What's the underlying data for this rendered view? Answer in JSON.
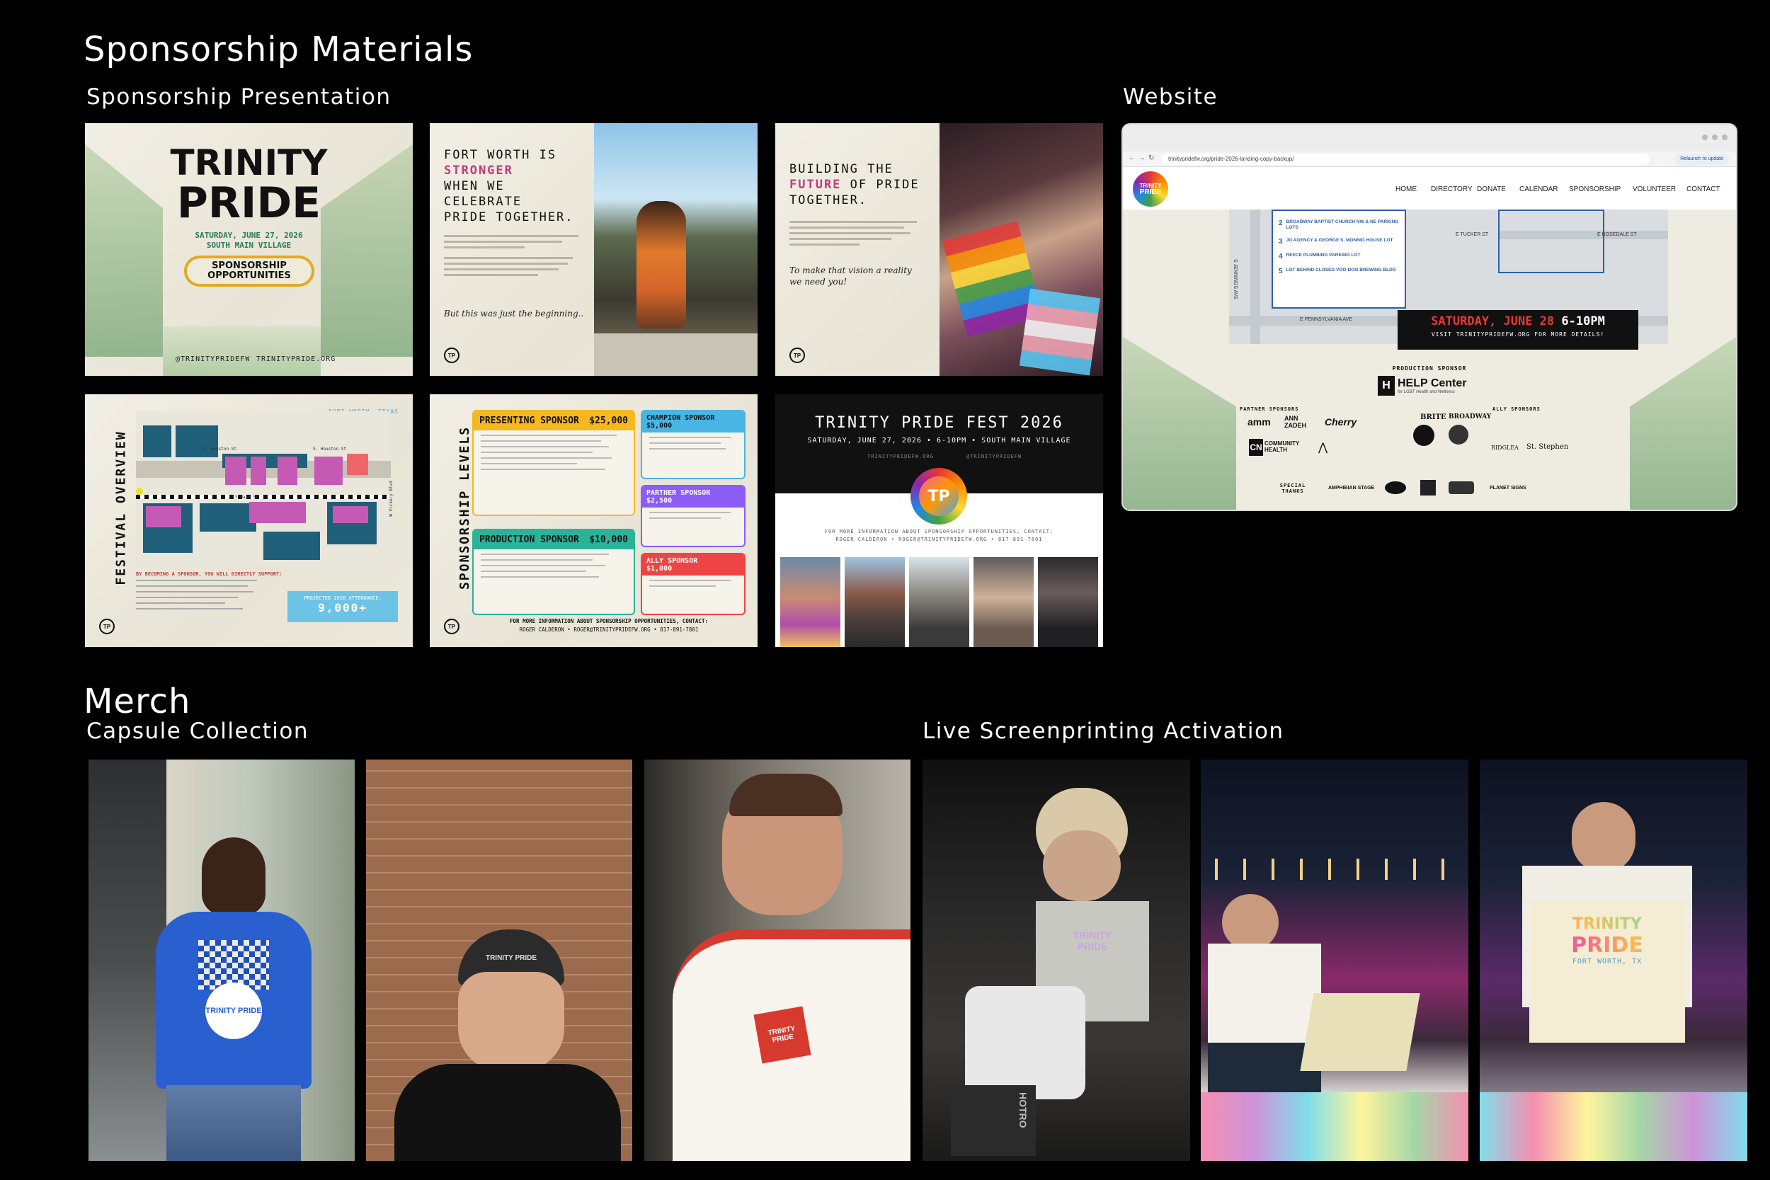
{
  "headings": {
    "sponsorship_materials": "Sponsorship Materials",
    "sponsorship_presentation": "Sponsorship Presentation",
    "website": "Website",
    "merch": "Merch",
    "capsule_collection": "Capsule Collection",
    "live_screenprinting": "Live Screenprinting Activation"
  },
  "slide1": {
    "title_line1": "TRINITY",
    "title_line2": "PRIDE",
    "date": "SATURDAY, JUNE 27, 2026",
    "venue": "SOUTH MAIN VILLAGE",
    "badge": "SPONSORSHIP OPPORTUNITIES",
    "handle": "@TRINITYPRIDEFW",
    "site": "TRINITYPRIDE.ORG"
  },
  "slide2": {
    "line1": "FORT WORTH IS",
    "line2": "STRONGER",
    "line3": "WHEN WE",
    "line4": "CELEBRATE",
    "line5": "PRIDE TOGETHER.",
    "tagline": "But this was just the beginning..",
    "logo": "TP"
  },
  "slide3": {
    "line1": "BUILDING THE",
    "line2": "FUTURE",
    "line2b": "OF PRIDE",
    "line3": "TOGETHER.",
    "tagline": "To make that vision a reality we need you!",
    "logo": "TP"
  },
  "slide4": {
    "vertical_title": "FESTIVAL OVERVIEW",
    "location": "FORT WORTH, TEXAS",
    "support_heading": "BY BECOMING A SPONSOR, YOU WILL DIRECTLY SUPPORT:",
    "attendance_label": "PROJECTED 2026 ATTENDANCE:",
    "attendance_value": "9,000+",
    "streets": [
      "S. Houston St",
      "S. Houston St",
      "S Main St",
      "W Vickery Blvd"
    ],
    "logo": "TP"
  },
  "slide5": {
    "vertical_title": "SPONSORSHIP LEVELS",
    "tiers": [
      {
        "name": "PRESENTING SPONSOR",
        "price": "$25,000",
        "color": "#f5b820"
      },
      {
        "name": "PRODUCTION SPONSOR",
        "price": "$10,000",
        "color": "#2bb39a"
      },
      {
        "name": "CHAMPION SPONSOR",
        "price": "$5,000",
        "color": "#48b5e4"
      },
      {
        "name": "PARTNER SPONSOR",
        "price": "$2,500",
        "color": "#8b5cf6"
      },
      {
        "name": "ALLY SPONSOR",
        "price": "$1,000",
        "color": "#ef4444"
      }
    ],
    "contact1": "FOR MORE INFORMATION ABOUT SPONSORSHIP OPPORTUNITIES, CONTACT:",
    "contact2": "ROGER CALDERON • ROGER@TRINITYPRIDEFW.ORG • 817-891-7801",
    "logo": "TP"
  },
  "slide6": {
    "title": "TRINITY PRIDE FEST 2026",
    "subtitle": "SATURDAY, JUNE 27, 2026 • 6-10PM • SOUTH MAIN VILLAGE",
    "site": "TRINITYPRIDEFW.ORG",
    "handle": "@TRINITYPRIDEFW",
    "contact1": "FOR MORE INFORMATION ABOUT SPONSORSHIP OPPORTUNITIES, CONTACT:",
    "contact2": "ROGER CALDERON • ROGER@TRINITYPRIDEFW.ORG • 817-891-7801",
    "logo": "TP"
  },
  "website": {
    "url": "trinitypridefw.org/pride-2026-landing-copy-backup/",
    "relaunch": "Relaunch to update",
    "logo_line1": "TRINITY",
    "logo_line2": "PRIDE",
    "nav": [
      "HOME",
      "DIRECTORY",
      "DONATE",
      "CALENDAR",
      "SPONSORSHIP",
      "VOLUNTEER",
      "CONTACT"
    ],
    "parking": [
      {
        "num": "2",
        "text": "BROADWAY BAPTIST CHURCH NW & NE PARKING LOTS"
      },
      {
        "num": "3",
        "text": "JO AGENCY & GEORGE S. MONNIG HOUSE LOT"
      },
      {
        "num": "4",
        "text": "REECE PLUMBING PARKING LOT"
      },
      {
        "num": "5",
        "text": "LOT BEHIND CLOSED VOO-DOO BREWING BLDG"
      }
    ],
    "street_rosedale": "E ROSEDALE ST",
    "street_jennings": "S JENNINGS AVE",
    "street_pennsylvania": "E PENNSYLVANIA AVE",
    "street_tucker": "E TUCKER ST",
    "banner_date": "SATURDAY, JUNE 28",
    "banner_time": "6-10PM",
    "banner_sub": "VISIT TRINITYPRIDEFW.ORG FOR MORE DETAILS!",
    "production_label": "PRODUCTION SPONSOR",
    "production_name": "HELP Center",
    "production_sub": "for LGBT Health and Wellness",
    "partner_label": "PARTNER SPONSORS",
    "ally_label": "ALLY SPONSORS",
    "special_label": "SPECIAL THANKS",
    "partner_logos": [
      "ANN ZADEH",
      "Cherry",
      "COMMUNITY HEALTH"
    ],
    "ally_logos": [
      "BRITE",
      "BROADWAY",
      "St. Stephen",
      "RIDGLEA"
    ],
    "special_logos": [
      "AMPHIBIAN STAGE",
      "PLANET SIGNS"
    ]
  },
  "merch": {
    "shirt1_text": "TRINITY PRIDE",
    "hat_text": "TRINITY PRIDE",
    "shirt3_text": "TRINITY PRIDE",
    "screen_shirt": "TRINITY PRIDE",
    "tote_line1": "TRINITY",
    "tote_line2": "PRIDE",
    "tote_line3": "FORT WORTH, TX",
    "press_text": "HOTRO"
  },
  "colors": {
    "background": "#000000",
    "paper": "#efebe0",
    "pride_green": "#0f6b4b",
    "pride_yellow": "#f0b429",
    "map_magenta": "#c45ab3",
    "map_teal": "#1f5f7a",
    "banner_red": "#e53935"
  }
}
